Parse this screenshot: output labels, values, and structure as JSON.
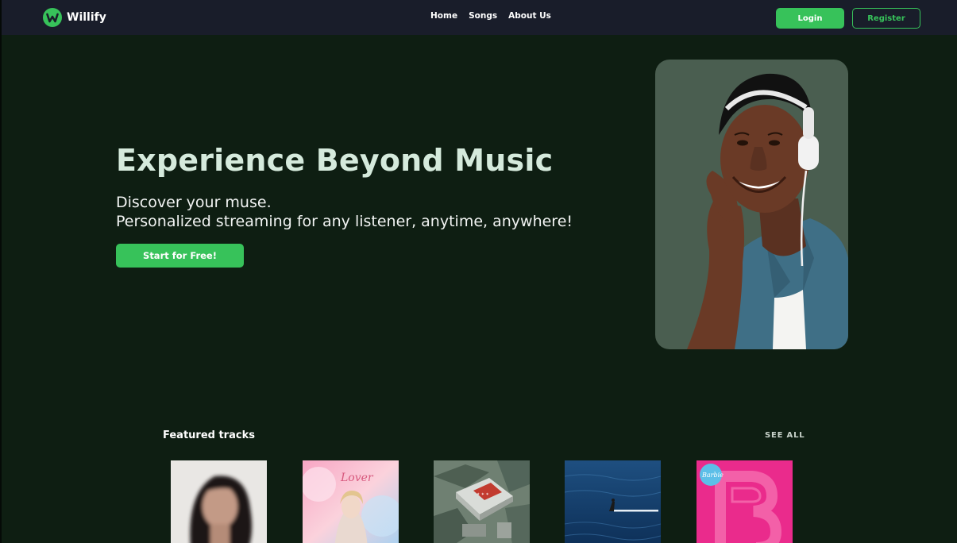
{
  "brand": {
    "name": "Willify",
    "accent_color": "#37c25a",
    "logo_icon": "w-logo-icon"
  },
  "nav": {
    "links": [
      "Home",
      "Songs",
      "About Us"
    ],
    "login_label": "Login",
    "register_label": "Register"
  },
  "hero": {
    "title": "Experience Beyond Music",
    "subtitle_line1": "Discover your muse.",
    "subtitle_line2": "Personalized streaming for any listener, anytime, anywhere!",
    "cta_label": "Start for Free!",
    "image": "man-with-headphones-photo"
  },
  "featured": {
    "title": "Featured tracks",
    "see_all_label": "SEE ALL",
    "tracks": [
      {
        "cover": "blurred-portrait-cover"
      },
      {
        "cover": "lover-album-cover",
        "cover_text": "Lover"
      },
      {
        "cover": "aerial-rooftop-cover"
      },
      {
        "cover": "ocean-surfer-cover"
      },
      {
        "cover": "barbie-album-cover",
        "cover_text": "Barbie"
      }
    ]
  }
}
